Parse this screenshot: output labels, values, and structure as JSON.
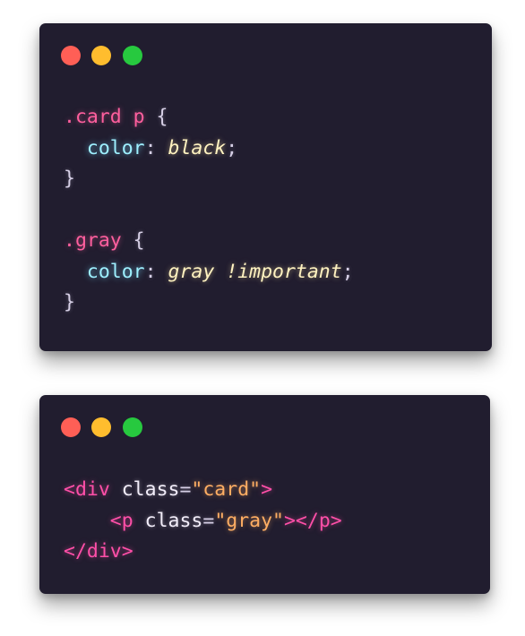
{
  "css_window": {
    "lines": [
      [
        {
          "t": ".card p",
          "c": "sel"
        },
        {
          "t": " {",
          "c": "punc"
        }
      ],
      [
        {
          "t": "  "
        },
        {
          "t": "color",
          "c": "prop"
        },
        {
          "t": ": ",
          "c": "punc"
        },
        {
          "t": "black",
          "c": "val"
        },
        {
          "t": ";",
          "c": "punc"
        }
      ],
      [
        {
          "t": "}",
          "c": "punc"
        }
      ],
      [],
      [
        {
          "t": ".gray",
          "c": "sel"
        },
        {
          "t": " {",
          "c": "punc"
        }
      ],
      [
        {
          "t": "  "
        },
        {
          "t": "color",
          "c": "prop"
        },
        {
          "t": ": ",
          "c": "punc"
        },
        {
          "t": "gray !important",
          "c": "val"
        },
        {
          "t": ";",
          "c": "punc"
        }
      ],
      [
        {
          "t": "}",
          "c": "punc"
        }
      ]
    ]
  },
  "html_window": {
    "lines": [
      [
        {
          "t": "<div",
          "c": "tag"
        },
        {
          "t": " "
        },
        {
          "t": "class",
          "c": "attr"
        },
        {
          "t": "=",
          "c": "punc"
        },
        {
          "t": "\"card\"",
          "c": "str"
        },
        {
          "t": ">",
          "c": "tag"
        }
      ],
      [
        {
          "t": "    "
        },
        {
          "t": "<p",
          "c": "tag"
        },
        {
          "t": " "
        },
        {
          "t": "class",
          "c": "attr"
        },
        {
          "t": "=",
          "c": "punc"
        },
        {
          "t": "\"gray\"",
          "c": "str"
        },
        {
          "t": "></p>",
          "c": "tag"
        }
      ],
      [
        {
          "t": "</div>",
          "c": "tag"
        }
      ]
    ]
  },
  "colors": {
    "window_bg": "#211d2f",
    "dot_red": "#ff5f56",
    "dot_yellow": "#ffbd2e",
    "dot_green": "#27c93f"
  }
}
